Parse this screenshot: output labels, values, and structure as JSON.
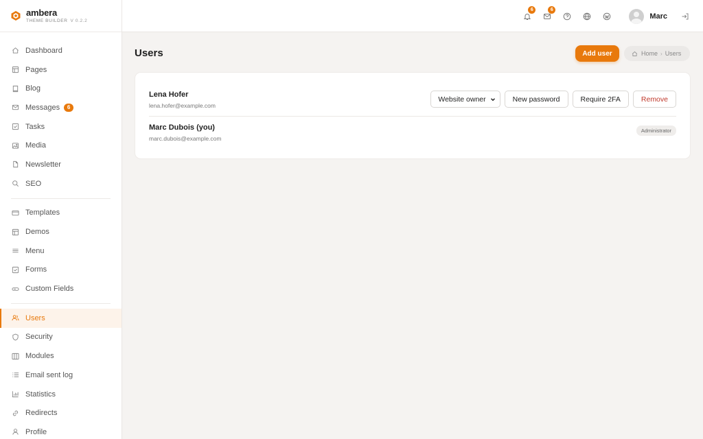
{
  "brand": {
    "name": "ambera",
    "subtitle": "THEME BUILDER",
    "version": "V 0.2.2"
  },
  "colors": {
    "accent": "#e8790c",
    "danger": "#c0392b",
    "background": "#f5f3f1"
  },
  "nav": {
    "group1": [
      {
        "label": "Dashboard",
        "icon": "home-icon"
      },
      {
        "label": "Pages",
        "icon": "layout-icon"
      },
      {
        "label": "Blog",
        "icon": "book-icon"
      },
      {
        "label": "Messages",
        "icon": "mail-icon",
        "badge": "6"
      },
      {
        "label": "Tasks",
        "icon": "checkbox-icon"
      },
      {
        "label": "Media",
        "icon": "image-icon"
      },
      {
        "label": "Newsletter",
        "icon": "file-icon"
      },
      {
        "label": "SEO",
        "icon": "search-icon"
      }
    ],
    "group2": [
      {
        "label": "Templates",
        "icon": "card-icon"
      },
      {
        "label": "Demos",
        "icon": "layout-icon"
      },
      {
        "label": "Menu",
        "icon": "menu-icon"
      },
      {
        "label": "Forms",
        "icon": "checkbox-icon"
      },
      {
        "label": "Custom Fields",
        "icon": "input-icon"
      }
    ],
    "group3": [
      {
        "label": "Users",
        "icon": "users-icon",
        "active": true
      },
      {
        "label": "Security",
        "icon": "shield-icon"
      },
      {
        "label": "Modules",
        "icon": "columns-icon"
      },
      {
        "label": "Email sent log",
        "icon": "list-icon"
      },
      {
        "label": "Statistics",
        "icon": "bar-chart-icon"
      },
      {
        "label": "Redirects",
        "icon": "link-icon"
      },
      {
        "label": "Profile",
        "icon": "user-icon"
      }
    ]
  },
  "header": {
    "notifications_badge": "6",
    "messages_badge": "6",
    "user_name": "Marc"
  },
  "page": {
    "title": "Users",
    "add_button": "Add user",
    "breadcrumb": {
      "home": "Home",
      "separator": "›",
      "current": "Users"
    }
  },
  "users": [
    {
      "name": "Lena Hofer",
      "email": "lena.hofer@example.com",
      "role_select": "Website owner",
      "actions": {
        "new_password": "New password",
        "require_2fa": "Require 2FA",
        "remove": "Remove"
      }
    },
    {
      "name": "Marc Dubois (you)",
      "email": "marc.dubois@example.com",
      "role_badge": "Administrator"
    }
  ]
}
